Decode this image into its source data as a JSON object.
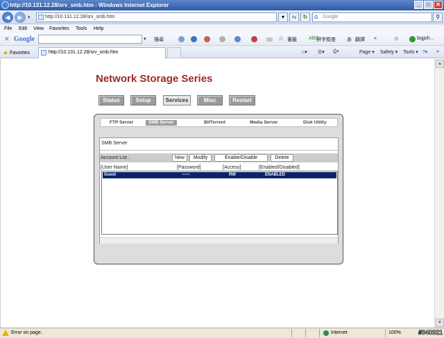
{
  "window": {
    "title": "http://10.131.12.28/srv_smb.htm - Windows Internet Explorer"
  },
  "address": {
    "url": "http://10.131.12.28/srv_smb.htm"
  },
  "search": {
    "placeholder": "Google"
  },
  "menu": {
    "file": "File",
    "edit": "Edit",
    "view": "View",
    "favorites": "Favorites",
    "tools": "Tools",
    "help": "Help"
  },
  "google_toolbar": {
    "brand": "Google",
    "search_label": "搜尋",
    "bookmarks": "書籤",
    "spellcheck": "拼字檢查",
    "translate": "翻譯",
    "user": "bigjoh..."
  },
  "tabs": {
    "favorites": "Favorites",
    "current_tab": "http://10.131.12.28/srv_smb.htm",
    "page": "Page",
    "safety": "Safety",
    "tools": "Tools"
  },
  "page": {
    "title": "Network Storage Series",
    "main_nav": [
      "Status",
      "Setup",
      "Services",
      "Misc",
      "Restart"
    ],
    "sub_tabs": [
      "FTP Server",
      "SMB Server",
      "BitTorrent",
      "Media Server",
      "Disk Utility"
    ],
    "section_title": "SMB Server",
    "account_list_label": "Account List :",
    "buttons": {
      "new": "New",
      "modify": "Modify",
      "enable_disable": "Enable/Disable",
      "delete": "Delete"
    },
    "columns": [
      "[User Name]",
      "[Password]",
      "[Access]",
      "[Enabled/Disabled]"
    ],
    "rows": [
      {
        "user": "Guest",
        "password": "------",
        "access": "RW",
        "status": "ENABLED"
      }
    ]
  },
  "status": {
    "text": "Error on page.",
    "zone": "Internet",
    "zoom": "100%",
    "watermark": "#340321"
  },
  "colors": {
    "title_red": "#9b2a2a",
    "nav_gray": "#9a9a9a",
    "selection_blue": "#0a246a"
  }
}
